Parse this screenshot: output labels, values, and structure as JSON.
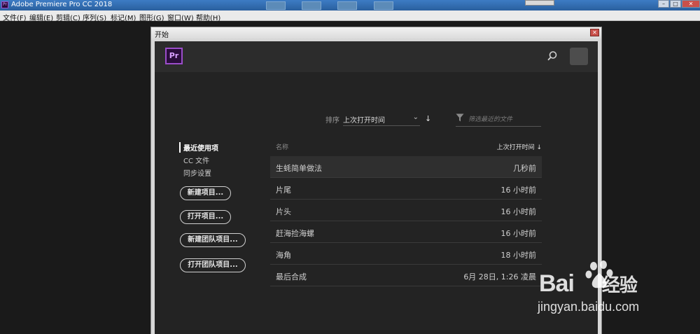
{
  "app": {
    "window_title": "Adobe Premiere Pro CC 2018",
    "menu": [
      "文件(F)",
      "编辑(E)",
      "剪辑(C)",
      "序列(S)",
      "标记(M)",
      "图形(G)",
      "窗口(W)",
      "帮助(H)"
    ]
  },
  "dialog": {
    "title": "开始",
    "logo_text": "Pr",
    "sort": {
      "label": "排序",
      "selected": "上次打开时间"
    },
    "filter": {
      "placeholder": "筛选最近的文件"
    },
    "nav": [
      {
        "label": "最近使用项",
        "active": true
      },
      {
        "label": "CC 文件",
        "active": false
      },
      {
        "label": "同步设置",
        "active": false
      }
    ],
    "buttons": {
      "new_project": "新建项目...",
      "open_project": "打开项目...",
      "new_team_project": "新建团队项目...",
      "open_team_project": "打开团队项目..."
    },
    "table": {
      "col_name": "名称",
      "col_date": "上次打开时间",
      "rows": [
        {
          "name": "生蚝简单做法",
          "date": "几秒前",
          "selected": true
        },
        {
          "name": "片尾",
          "date": "16 小时前"
        },
        {
          "name": "片头",
          "date": "16 小时前"
        },
        {
          "name": "赶海捡海螺",
          "date": "16 小时前"
        },
        {
          "name": "海角",
          "date": "18 小时前"
        },
        {
          "name": "最后合成",
          "date": "6月 28日, 1:26 凌晨"
        }
      ]
    }
  },
  "watermark": {
    "brand": "Bai",
    "brand_cn": "经验",
    "url": "jingyan.baidu.com"
  },
  "colors": {
    "accent_purple": "#9b4dca",
    "panel_bg": "#232323",
    "header_bg": "#2c2c2c"
  }
}
